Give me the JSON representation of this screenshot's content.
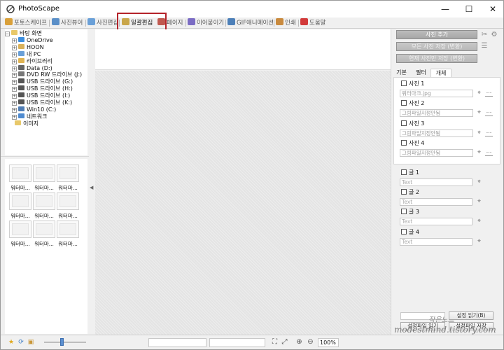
{
  "window": {
    "title": "PhotoScape",
    "minimize": "—",
    "maximize": "☐",
    "close": "✕"
  },
  "tabs": [
    {
      "label": "포토스케이프",
      "color": "#d9a03a"
    },
    {
      "label": "사진뷰어",
      "color": "#5a8fc8"
    },
    {
      "label": "사진편집",
      "color": "#6aa0d8"
    },
    {
      "label": "일괄편집",
      "color": "#c9a64a",
      "active": true
    },
    {
      "label": "페이지",
      "color": "#c0584f"
    },
    {
      "label": "이어붙이기",
      "color": "#7b6cc4"
    },
    {
      "label": "GIF애니메이션",
      "color": "#4c7fb8"
    },
    {
      "label": "인쇄",
      "color": "#c98a3e"
    },
    {
      "label": "도움말",
      "color": "#d23a3a"
    }
  ],
  "tree": [
    {
      "label": "바탕 화면",
      "exp": "⊟",
      "icon": "#e8c86a"
    },
    {
      "label": "OneDrive",
      "exp": "⊞",
      "icon": "#3b8ee0"
    },
    {
      "label": "HOON",
      "exp": "⊞",
      "icon": "#d9b15a"
    },
    {
      "label": "내 PC",
      "exp": "⊞",
      "icon": "#6aa0d8"
    },
    {
      "label": "라이브러리",
      "exp": "⊞",
      "icon": "#e0b453"
    },
    {
      "label": "Data (D:)",
      "exp": "⊞",
      "icon": "#666666"
    },
    {
      "label": "DVD RW 드라이브 (J:)",
      "exp": "⊞",
      "icon": "#777777"
    },
    {
      "label": "USB 드라이브 (G:)",
      "exp": "⊞",
      "icon": "#555555"
    },
    {
      "label": "USB 드라이브 (H:)",
      "exp": "⊞",
      "icon": "#555555"
    },
    {
      "label": "USB 드라이브 (I:)",
      "exp": "⊞",
      "icon": "#555555"
    },
    {
      "label": "USB 드라이브 (K:)",
      "exp": "⊞",
      "icon": "#555555"
    },
    {
      "label": "Win10 (C:)",
      "exp": "⊞",
      "icon": "#4f7db5"
    },
    {
      "label": "네트워크",
      "exp": "⊞",
      "icon": "#4f8bd0"
    },
    {
      "label": "이미지",
      "exp": "",
      "icon": "#e8c86a"
    }
  ],
  "thumbnails": [
    {
      "label": "워터마..."
    },
    {
      "label": "워터마..."
    },
    {
      "label": "워터마..."
    },
    {
      "label": "워터마..."
    },
    {
      "label": "워터마..."
    },
    {
      "label": "워터마..."
    },
    {
      "label": "워터마..."
    },
    {
      "label": "워터마..."
    },
    {
      "label": "워터마..."
    }
  ],
  "right": {
    "add_photo": "사진 추가",
    "save_all": "모든 사진 저장 (변환)",
    "save_current": "현재 사진만 저장 (변환)",
    "tabs": [
      "기본",
      "필터",
      "개체"
    ],
    "photos": [
      {
        "label": "사진 1",
        "value": "워터마크.jpg"
      },
      {
        "label": "사진 2",
        "value": "그림파일지정안됨"
      },
      {
        "label": "사진 3",
        "value": "그림파일지정안됨"
      },
      {
        "label": "사진 4",
        "value": "그림파일지정안됨"
      }
    ],
    "texts": [
      {
        "label": "글 1",
        "placeholder": "Text"
      },
      {
        "label": "글 2",
        "placeholder": "Text"
      },
      {
        "label": "글 3",
        "placeholder": "Text"
      },
      {
        "label": "글 4",
        "placeholder": "Text"
      }
    ],
    "buttons": {
      "settings_load": "설정 읽기(B)",
      "settings_file_load": "설정파일 읽기",
      "settings_file_save": "설정파일 저장"
    },
    "watermark_kr": "작은노트",
    "watermark_url": "modestmind.tistory.com"
  },
  "status": {
    "zoom": "100%"
  }
}
